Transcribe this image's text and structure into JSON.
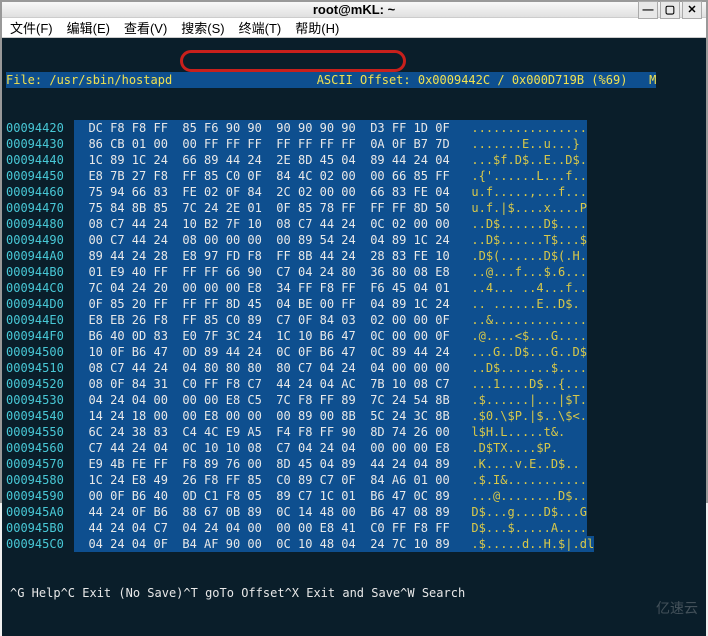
{
  "window": {
    "title": "root@mKL: ~"
  },
  "menu": {
    "file": "文件(F)",
    "edit": "编辑(E)",
    "view": "查看(V)",
    "search": "搜索(S)",
    "terminal": "终端(T)",
    "help": "帮助(H)"
  },
  "status": {
    "file_label": "File:",
    "file_path": "/usr/sbin/hostapd",
    "ascii_label": "ASCII",
    "offset_label": "Offset:",
    "offset_val": "0x0009442C",
    "slash": "/",
    "size_val": "0x000D719B",
    "pct": "(%69)",
    "mode": "M"
  },
  "rows": [
    {
      "off": "00094420",
      "hex": "DC F8 F8 FF  85 F6 90 90  90 90 90 90  D3 FF 1D 0F ",
      "asc": "................"
    },
    {
      "off": "00094430",
      "hex": "86 CB 01 00  00 FF FF FF  FF FF FF FF  0A 0F B7 7D ",
      "asc": ".......E..u...}"
    },
    {
      "off": "00094440",
      "hex": "1C 89 1C 24  66 89 44 24  2E 8D 45 04  89 44 24 04 ",
      "asc": "...$f.D$..E..D$."
    },
    {
      "off": "00094450",
      "hex": "E8 7B 27 F8  FF 85 C0 0F  84 4C 02 00  00 66 85 FF ",
      "asc": ".{'......L...f.."
    },
    {
      "off": "00094460",
      "hex": "75 94 66 83  FE 02 0F 84  2C 02 00 00  66 83 FE 04 ",
      "asc": "u.f.....,...f..."
    },
    {
      "off": "00094470",
      "hex": "75 84 8B 85  7C 24 2E 01  0F 85 78 FF  FF FF 8D 50 ",
      "asc": "u.f.|$....x....P"
    },
    {
      "off": "00094480",
      "hex": "08 C7 44 24  10 B2 7F 10  08 C7 44 24  0C 02 00 00 ",
      "asc": "..D$......D$...."
    },
    {
      "off": "00094490",
      "hex": "00 C7 44 24  08 00 00 00  00 89 54 24  04 89 1C 24 ",
      "asc": "..D$......T$...$"
    },
    {
      "off": "000944A0",
      "hex": "89 44 24 28  E8 97 FD F8  FF 8B 44 24  28 83 FE 10 ",
      "asc": ".D$(......D$(.H."
    },
    {
      "off": "000944B0",
      "hex": "01 E9 40 FF  FF FF 66 90  C7 04 24 80  36 80 08 E8 ",
      "asc": "..@...f...$.6..."
    },
    {
      "off": "000944C0",
      "hex": "7C 04 24 20  00 00 00 E8  34 FF F8 FF  F6 45 04 01 ",
      "asc": "..4... ..4...f.."
    },
    {
      "off": "000944D0",
      "hex": "0F 85 20 FF  FF FF 8D 45  04 BE 00 FF  04 89 1C 24 ",
      "asc": ".. ......E..D$."
    },
    {
      "off": "000944E0",
      "hex": "E8 EB 26 F8  FF 85 C0 89  C7 0F 84 03  02 00 00 0F ",
      "asc": "..&............."
    },
    {
      "off": "000944F0",
      "hex": "B6 40 0D 83  E0 7F 3C 24  1C 10 B6 47  0C 00 00 0F ",
      "asc": ".@....<$...G...."
    },
    {
      "off": "00094500",
      "hex": "10 0F B6 47  0D 89 44 24  0C 0F B6 47  0C 89 44 24 ",
      "asc": "...G..D$...G..D$"
    },
    {
      "off": "00094510",
      "hex": "08 C7 44 24  04 80 80 80  80 C7 04 24  04 00 00 00 ",
      "asc": "..D$.......$...."
    },
    {
      "off": "00094520",
      "hex": "08 0F 84 31  C0 FF F8 C7  44 24 04 AC  7B 10 08 C7 ",
      "asc": "...1....D$..{..."
    },
    {
      "off": "00094530",
      "hex": "04 24 04 00  00 00 E8 C5  7C F8 FF 89  7C 24 54 8B ",
      "asc": ".$......|...|$T."
    },
    {
      "off": "00094540",
      "hex": "14 24 18 00  00 E8 00 00  00 89 00 8B  5C 24 3C 8B ",
      "asc": ".$0.\\$P.|$..\\$<."
    },
    {
      "off": "00094550",
      "hex": "6C 24 38 83  C4 4C E9 A5  F4 F8 FF 90  8D 74 26 00 ",
      "asc": "l$H.L.....t&."
    },
    {
      "off": "00094560",
      "hex": "C7 44 24 04  0C 10 10 08  C7 04 24 04  00 00 00 E8 ",
      "asc": ".D$TX....$P."
    },
    {
      "off": "00094570",
      "hex": "E9 4B FE FF  F8 89 76 00  8D 45 04 89  44 24 04 89 ",
      "asc": ".K....v.E..D$.."
    },
    {
      "off": "00094580",
      "hex": "1C 24 E8 49  26 F8 FF 85  C0 89 C7 0F  84 A6 01 00 ",
      "asc": ".$.I&..........."
    },
    {
      "off": "00094590",
      "hex": "00 0F B6 40  0D C1 F8 05  89 C7 1C 01  B6 47 0C 89 ",
      "asc": "...@........D$.."
    },
    {
      "off": "000945A0",
      "hex": "44 24 0F B6  88 67 0B 89  0C 14 48 00  B6 47 08 89 ",
      "asc": "D$...g....D$...G"
    },
    {
      "off": "000945B0",
      "hex": "44 24 04 C7  04 24 04 00  00 00 E8 41  C0 FF F8 FF ",
      "asc": "D$...$.....A...."
    },
    {
      "off": "000945C0",
      "hex": "04 24 04 0F  B4 AF 90 00  0C 10 48 04  24 7C 10 89 ",
      "asc": ".$.....d..H.$|.dl"
    }
  ],
  "footer": {
    "help": "^G Help",
    "exit": "^C Exit (No Save)",
    "goto": "^T goTo Offset",
    "exitsave": "^X Exit and Save",
    "search": "^W Search"
  },
  "watermark": "亿速云"
}
